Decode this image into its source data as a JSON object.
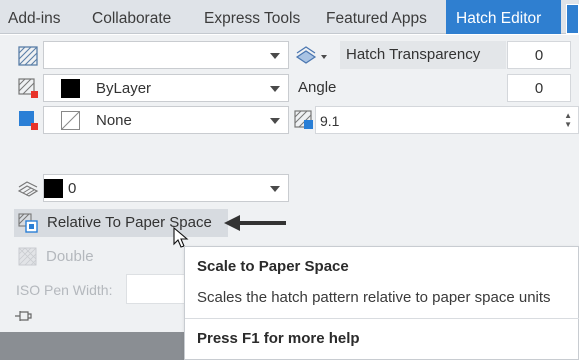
{
  "ribbon": {
    "tabs": [
      {
        "label": "Add-ins"
      },
      {
        "label": "Collaborate"
      },
      {
        "label": "Express Tools"
      },
      {
        "label": "Featured Apps"
      },
      {
        "label": "Hatch Editor"
      }
    ],
    "active_tab": "Hatch Editor",
    "accent_color": "#2f7fd0"
  },
  "properties": {
    "hatch_type": {
      "value": "",
      "icon": "hatch-type-icon"
    },
    "hatch_color": {
      "value": "ByLayer",
      "swatch_color": "#000000",
      "icon": "hatch-color-icon"
    },
    "background_color": {
      "value": "None",
      "icon": "background-color-icon"
    },
    "layer_override": {
      "value": "0",
      "swatch_color": "#000000",
      "icon": "layer-icon"
    },
    "transparency": {
      "label": "Hatch Transparency",
      "value": "0",
      "icon": "transparency-icon"
    },
    "angle": {
      "label": "Angle",
      "value": "0"
    },
    "scale": {
      "value": "9.1",
      "icon": "scale-icon"
    },
    "relative_to_paper_space": {
      "label": "Relative To Paper Space",
      "icon": "paper-space-icon"
    },
    "double": {
      "label": "Double",
      "icon": "double-icon"
    },
    "iso_pen_width": {
      "label": "ISO Pen Width:",
      "value": ""
    }
  },
  "tooltip": {
    "title": "Scale to Paper Space",
    "description": "Scales the hatch pattern relative to paper space units",
    "help": "Press F1 for more help"
  }
}
